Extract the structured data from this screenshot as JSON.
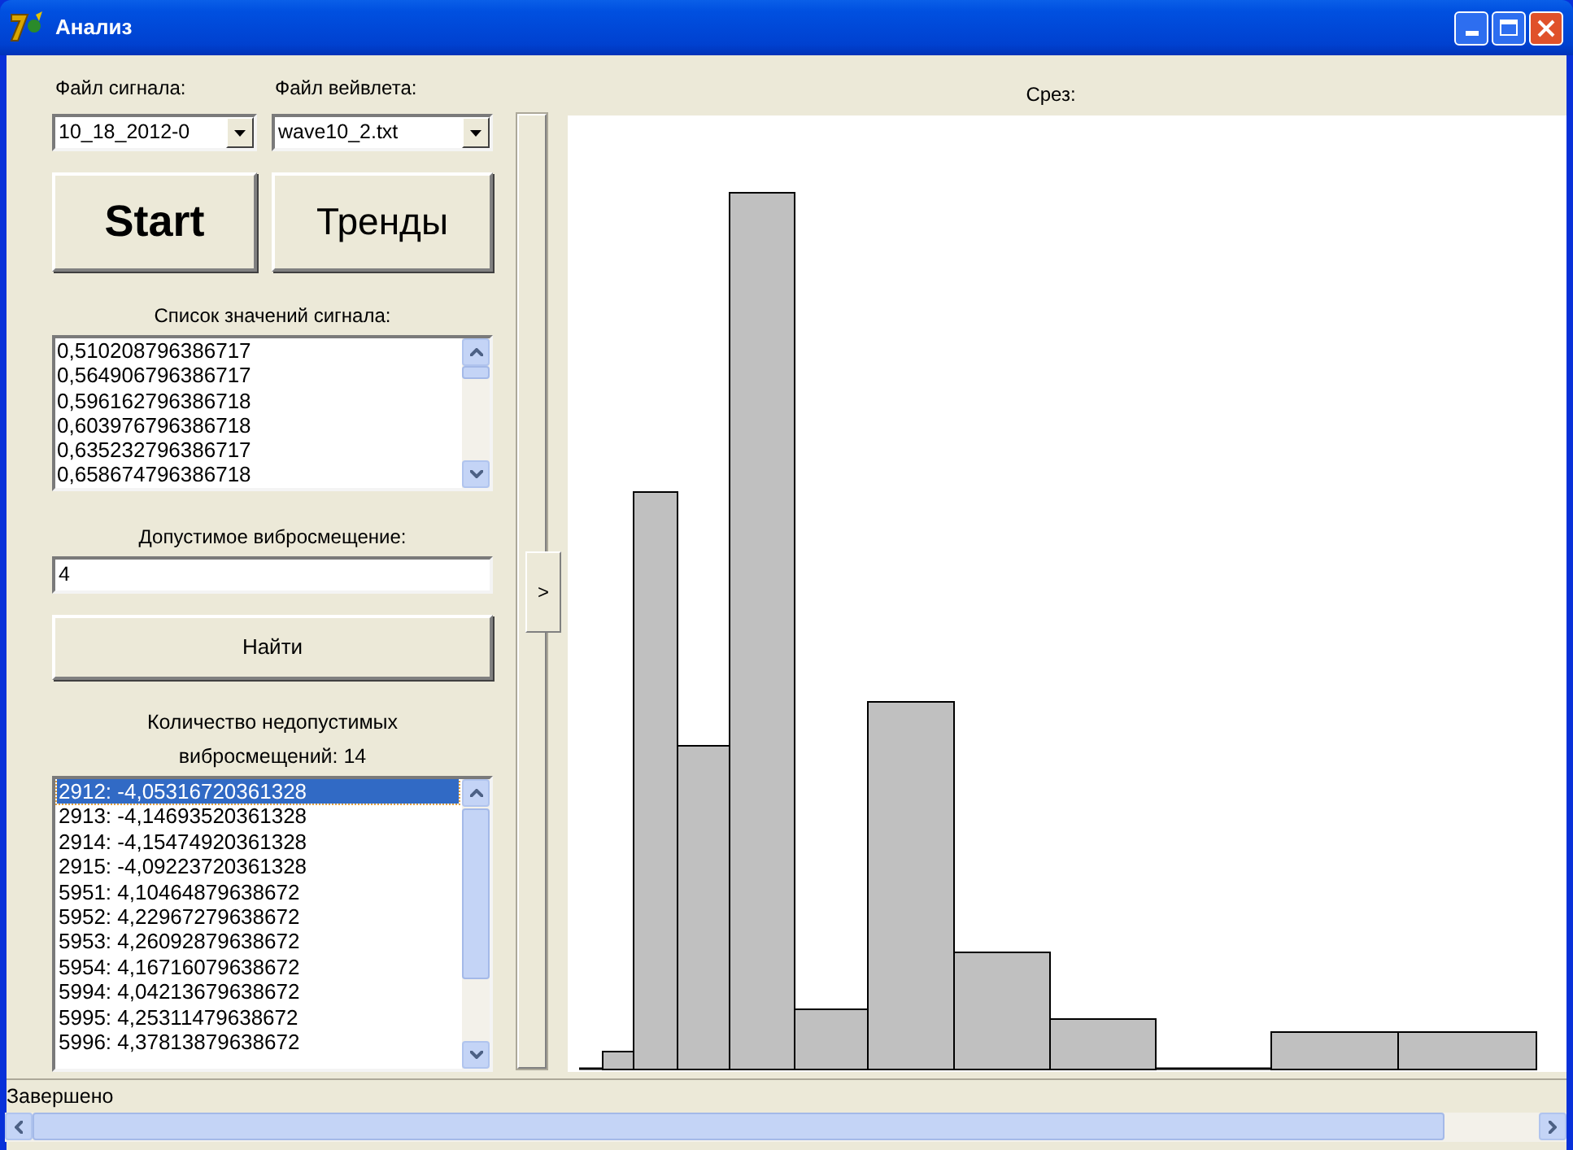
{
  "window": {
    "title": "Анализ"
  },
  "signal_file": {
    "label": "Файл сигнала:",
    "value": "10_18_2012-0"
  },
  "wavelet_file": {
    "label": "Файл вейвлета:",
    "value": "wave10_2.txt"
  },
  "buttons": [
    {
      "label": "Start",
      "kind": "big"
    },
    {
      "label": "Тренды",
      "kind": "big"
    }
  ],
  "signal_list": {
    "label": "Список значений сигнала:",
    "items": [
      "0,510208796386717",
      "0,564906796386717",
      "0,596162796386718",
      "0,603976796386718",
      "0,635232796386717",
      "0,658674796386718"
    ]
  },
  "threshold": {
    "label": "Допустимое виброcмещение:",
    "value": "4"
  },
  "find_button": {
    "label": "Найти"
  },
  "violations": {
    "label": "Количество недопустимых виброcмещений: 14",
    "items": [
      {
        "text": "2912: -4,05316720361328",
        "selected": true
      },
      {
        "text": "2913: -4,14693520361328",
        "selected": false
      },
      {
        "text": "2914: -4,15474920361328",
        "selected": false
      },
      {
        "text": "2915: -4,09223720361328",
        "selected": false
      },
      {
        "text": "5951: 4,10464879638672",
        "selected": false
      },
      {
        "text": "5952: 4,22967279638672",
        "selected": false
      },
      {
        "text": "5953: 4,26092879638672",
        "selected": false
      },
      {
        "text": "5954: 4,16716079638672",
        "selected": false
      },
      {
        "text": "5994: 4,04213679638672",
        "selected": false
      },
      {
        "text": "5995: 4,25311479638672",
        "selected": false
      },
      {
        "text": "5996: 4,37813879638672",
        "selected": false
      }
    ]
  },
  "splitter_button": ">",
  "slice": {
    "label": "Срез:"
  },
  "status_bar": "Завершено"
}
